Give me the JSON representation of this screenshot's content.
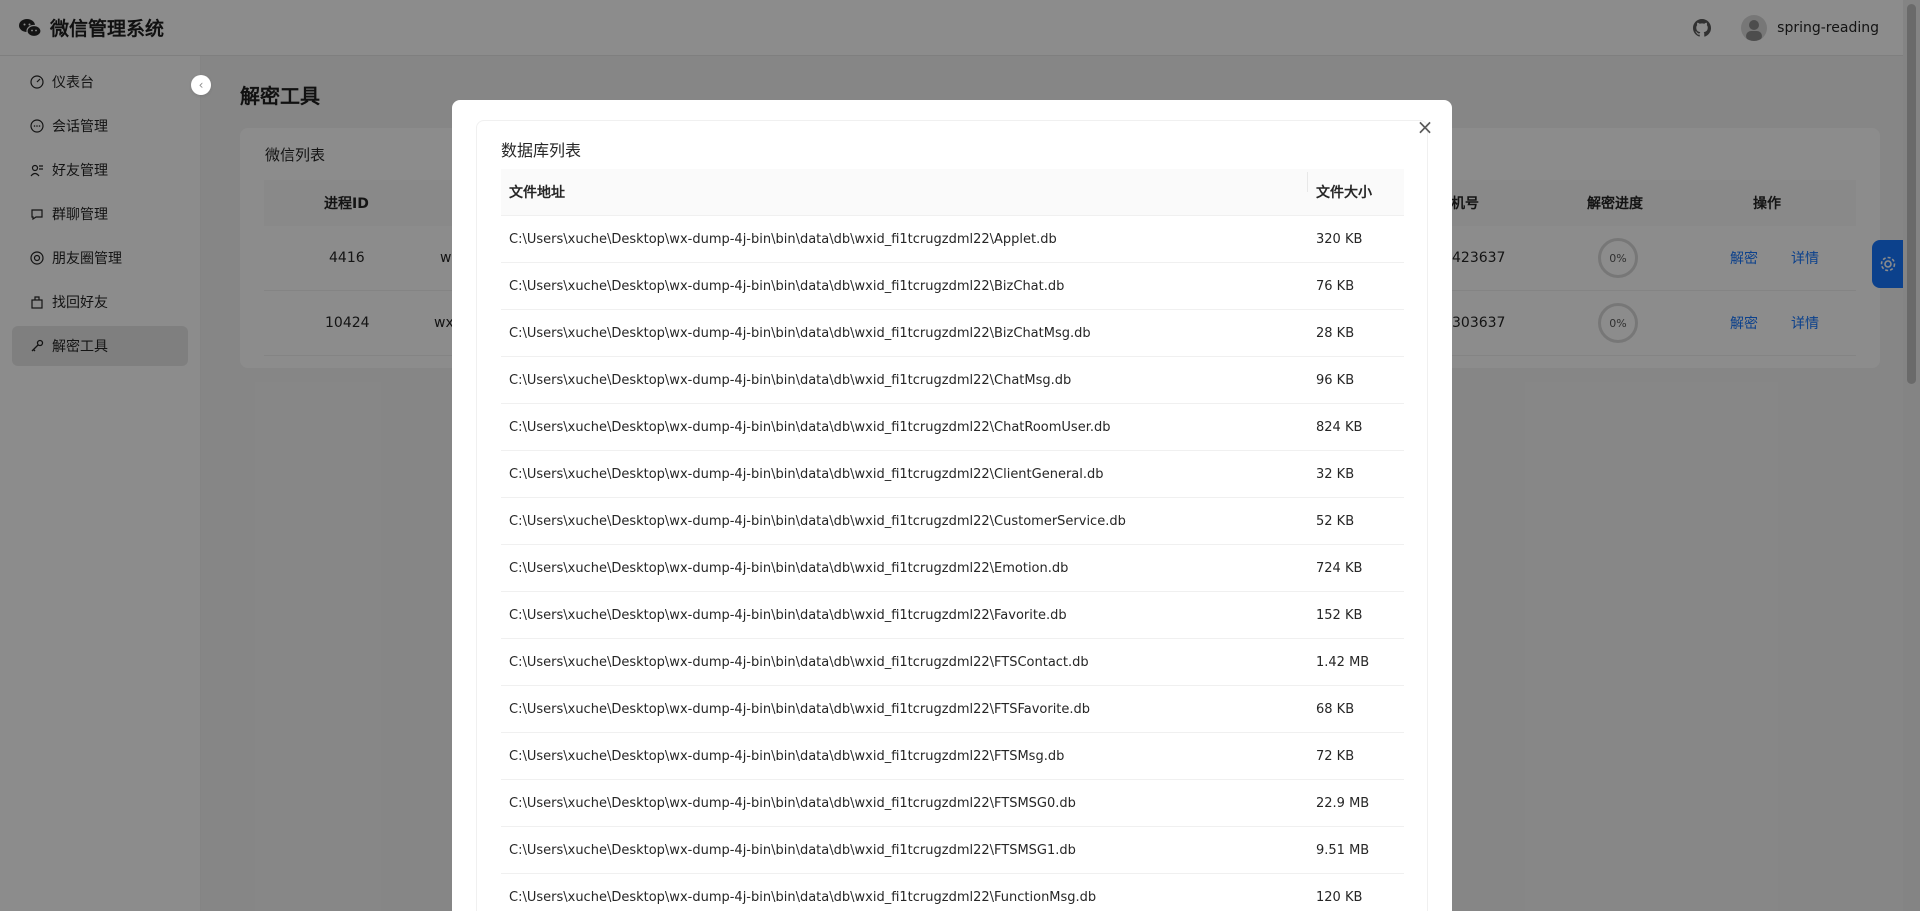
{
  "header": {
    "app_title": "微信管理系统",
    "username": "spring-reading"
  },
  "sidebar": {
    "items": [
      {
        "label": "仪表台",
        "icon": "dashboard-icon"
      },
      {
        "label": "会话管理",
        "icon": "chat-icon"
      },
      {
        "label": "好友管理",
        "icon": "friends-icon"
      },
      {
        "label": "群聊管理",
        "icon": "group-chat-icon"
      },
      {
        "label": "朋友圈管理",
        "icon": "moments-icon"
      },
      {
        "label": "找回好友",
        "icon": "recover-icon"
      },
      {
        "label": "解密工具",
        "icon": "key-icon",
        "active": true
      }
    ]
  },
  "main": {
    "page_title": "解密工具",
    "card_title": "微信列表",
    "columns": {
      "pid": "进程ID",
      "phone": "机号",
      "progress": "解密进度",
      "actions": "操作"
    },
    "rows": [
      {
        "pid": "4416",
        "wx": "w",
        "phone": "423637",
        "progress": "0%"
      },
      {
        "pid": "10424",
        "wx": "wx",
        "phone": "303637",
        "progress": "0%"
      }
    ],
    "actions": {
      "decrypt": "解密",
      "detail": "详情"
    }
  },
  "modal": {
    "title": "数据库列表",
    "columns": {
      "path": "文件地址",
      "size": "文件大小"
    },
    "rows": [
      {
        "path": "C:\\Users\\xuche\\Desktop\\wx-dump-4j-bin\\bin\\data\\db\\wxid_fi1tcrugzdml22\\Applet.db",
        "size": "320 KB"
      },
      {
        "path": "C:\\Users\\xuche\\Desktop\\wx-dump-4j-bin\\bin\\data\\db\\wxid_fi1tcrugzdml22\\BizChat.db",
        "size": "76 KB"
      },
      {
        "path": "C:\\Users\\xuche\\Desktop\\wx-dump-4j-bin\\bin\\data\\db\\wxid_fi1tcrugzdml22\\BizChatMsg.db",
        "size": "28 KB"
      },
      {
        "path": "C:\\Users\\xuche\\Desktop\\wx-dump-4j-bin\\bin\\data\\db\\wxid_fi1tcrugzdml22\\ChatMsg.db",
        "size": "96 KB"
      },
      {
        "path": "C:\\Users\\xuche\\Desktop\\wx-dump-4j-bin\\bin\\data\\db\\wxid_fi1tcrugzdml22\\ChatRoomUser.db",
        "size": "824 KB"
      },
      {
        "path": "C:\\Users\\xuche\\Desktop\\wx-dump-4j-bin\\bin\\data\\db\\wxid_fi1tcrugzdml22\\ClientGeneral.db",
        "size": "32 KB"
      },
      {
        "path": "C:\\Users\\xuche\\Desktop\\wx-dump-4j-bin\\bin\\data\\db\\wxid_fi1tcrugzdml22\\CustomerService.db",
        "size": "52 KB"
      },
      {
        "path": "C:\\Users\\xuche\\Desktop\\wx-dump-4j-bin\\bin\\data\\db\\wxid_fi1tcrugzdml22\\Emotion.db",
        "size": "724 KB"
      },
      {
        "path": "C:\\Users\\xuche\\Desktop\\wx-dump-4j-bin\\bin\\data\\db\\wxid_fi1tcrugzdml22\\Favorite.db",
        "size": "152 KB"
      },
      {
        "path": "C:\\Users\\xuche\\Desktop\\wx-dump-4j-bin\\bin\\data\\db\\wxid_fi1tcrugzdml22\\FTSContact.db",
        "size": "1.42 MB"
      },
      {
        "path": "C:\\Users\\xuche\\Desktop\\wx-dump-4j-bin\\bin\\data\\db\\wxid_fi1tcrugzdml22\\FTSFavorite.db",
        "size": "68 KB"
      },
      {
        "path": "C:\\Users\\xuche\\Desktop\\wx-dump-4j-bin\\bin\\data\\db\\wxid_fi1tcrugzdml22\\FTSMsg.db",
        "size": "72 KB"
      },
      {
        "path": "C:\\Users\\xuche\\Desktop\\wx-dump-4j-bin\\bin\\data\\db\\wxid_fi1tcrugzdml22\\FTSMSG0.db",
        "size": "22.9 MB"
      },
      {
        "path": "C:\\Users\\xuche\\Desktop\\wx-dump-4j-bin\\bin\\data\\db\\wxid_fi1tcrugzdml22\\FTSMSG1.db",
        "size": "9.51 MB"
      },
      {
        "path": "C:\\Users\\xuche\\Desktop\\wx-dump-4j-bin\\bin\\data\\db\\wxid_fi1tcrugzdml22\\FunctionMsg.db",
        "size": "120 KB"
      }
    ]
  },
  "colors": {
    "accent": "#1677ff",
    "mask": "rgba(0,0,0,0.45)"
  }
}
